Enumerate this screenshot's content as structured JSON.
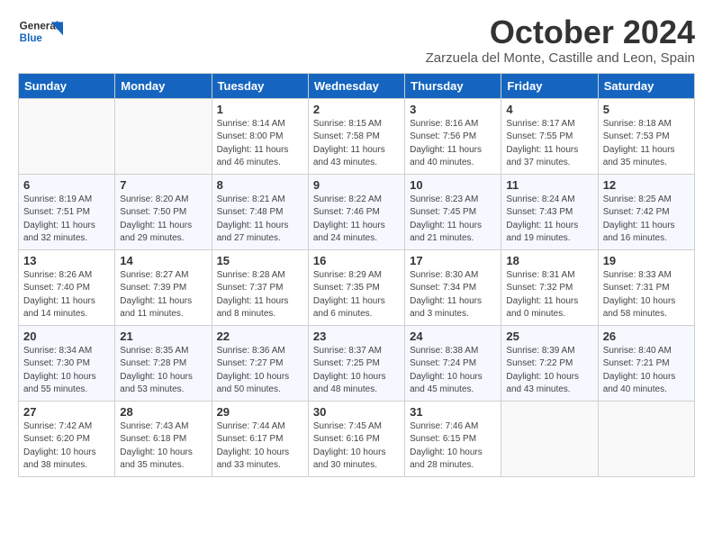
{
  "header": {
    "logo_general": "General",
    "logo_blue": "Blue",
    "month_title": "October 2024",
    "subtitle": "Zarzuela del Monte, Castille and Leon, Spain"
  },
  "weekdays": [
    "Sunday",
    "Monday",
    "Tuesday",
    "Wednesday",
    "Thursday",
    "Friday",
    "Saturday"
  ],
  "weeks": [
    [
      {
        "day": "",
        "info": ""
      },
      {
        "day": "",
        "info": ""
      },
      {
        "day": "1",
        "info": "Sunrise: 8:14 AM\nSunset: 8:00 PM\nDaylight: 11 hours and 46 minutes."
      },
      {
        "day": "2",
        "info": "Sunrise: 8:15 AM\nSunset: 7:58 PM\nDaylight: 11 hours and 43 minutes."
      },
      {
        "day": "3",
        "info": "Sunrise: 8:16 AM\nSunset: 7:56 PM\nDaylight: 11 hours and 40 minutes."
      },
      {
        "day": "4",
        "info": "Sunrise: 8:17 AM\nSunset: 7:55 PM\nDaylight: 11 hours and 37 minutes."
      },
      {
        "day": "5",
        "info": "Sunrise: 8:18 AM\nSunset: 7:53 PM\nDaylight: 11 hours and 35 minutes."
      }
    ],
    [
      {
        "day": "6",
        "info": "Sunrise: 8:19 AM\nSunset: 7:51 PM\nDaylight: 11 hours and 32 minutes."
      },
      {
        "day": "7",
        "info": "Sunrise: 8:20 AM\nSunset: 7:50 PM\nDaylight: 11 hours and 29 minutes."
      },
      {
        "day": "8",
        "info": "Sunrise: 8:21 AM\nSunset: 7:48 PM\nDaylight: 11 hours and 27 minutes."
      },
      {
        "day": "9",
        "info": "Sunrise: 8:22 AM\nSunset: 7:46 PM\nDaylight: 11 hours and 24 minutes."
      },
      {
        "day": "10",
        "info": "Sunrise: 8:23 AM\nSunset: 7:45 PM\nDaylight: 11 hours and 21 minutes."
      },
      {
        "day": "11",
        "info": "Sunrise: 8:24 AM\nSunset: 7:43 PM\nDaylight: 11 hours and 19 minutes."
      },
      {
        "day": "12",
        "info": "Sunrise: 8:25 AM\nSunset: 7:42 PM\nDaylight: 11 hours and 16 minutes."
      }
    ],
    [
      {
        "day": "13",
        "info": "Sunrise: 8:26 AM\nSunset: 7:40 PM\nDaylight: 11 hours and 14 minutes."
      },
      {
        "day": "14",
        "info": "Sunrise: 8:27 AM\nSunset: 7:39 PM\nDaylight: 11 hours and 11 minutes."
      },
      {
        "day": "15",
        "info": "Sunrise: 8:28 AM\nSunset: 7:37 PM\nDaylight: 11 hours and 8 minutes."
      },
      {
        "day": "16",
        "info": "Sunrise: 8:29 AM\nSunset: 7:35 PM\nDaylight: 11 hours and 6 minutes."
      },
      {
        "day": "17",
        "info": "Sunrise: 8:30 AM\nSunset: 7:34 PM\nDaylight: 11 hours and 3 minutes."
      },
      {
        "day": "18",
        "info": "Sunrise: 8:31 AM\nSunset: 7:32 PM\nDaylight: 11 hours and 0 minutes."
      },
      {
        "day": "19",
        "info": "Sunrise: 8:33 AM\nSunset: 7:31 PM\nDaylight: 10 hours and 58 minutes."
      }
    ],
    [
      {
        "day": "20",
        "info": "Sunrise: 8:34 AM\nSunset: 7:30 PM\nDaylight: 10 hours and 55 minutes."
      },
      {
        "day": "21",
        "info": "Sunrise: 8:35 AM\nSunset: 7:28 PM\nDaylight: 10 hours and 53 minutes."
      },
      {
        "day": "22",
        "info": "Sunrise: 8:36 AM\nSunset: 7:27 PM\nDaylight: 10 hours and 50 minutes."
      },
      {
        "day": "23",
        "info": "Sunrise: 8:37 AM\nSunset: 7:25 PM\nDaylight: 10 hours and 48 minutes."
      },
      {
        "day": "24",
        "info": "Sunrise: 8:38 AM\nSunset: 7:24 PM\nDaylight: 10 hours and 45 minutes."
      },
      {
        "day": "25",
        "info": "Sunrise: 8:39 AM\nSunset: 7:22 PM\nDaylight: 10 hours and 43 minutes."
      },
      {
        "day": "26",
        "info": "Sunrise: 8:40 AM\nSunset: 7:21 PM\nDaylight: 10 hours and 40 minutes."
      }
    ],
    [
      {
        "day": "27",
        "info": "Sunrise: 7:42 AM\nSunset: 6:20 PM\nDaylight: 10 hours and 38 minutes."
      },
      {
        "day": "28",
        "info": "Sunrise: 7:43 AM\nSunset: 6:18 PM\nDaylight: 10 hours and 35 minutes."
      },
      {
        "day": "29",
        "info": "Sunrise: 7:44 AM\nSunset: 6:17 PM\nDaylight: 10 hours and 33 minutes."
      },
      {
        "day": "30",
        "info": "Sunrise: 7:45 AM\nSunset: 6:16 PM\nDaylight: 10 hours and 30 minutes."
      },
      {
        "day": "31",
        "info": "Sunrise: 7:46 AM\nSunset: 6:15 PM\nDaylight: 10 hours and 28 minutes."
      },
      {
        "day": "",
        "info": ""
      },
      {
        "day": "",
        "info": ""
      }
    ]
  ]
}
